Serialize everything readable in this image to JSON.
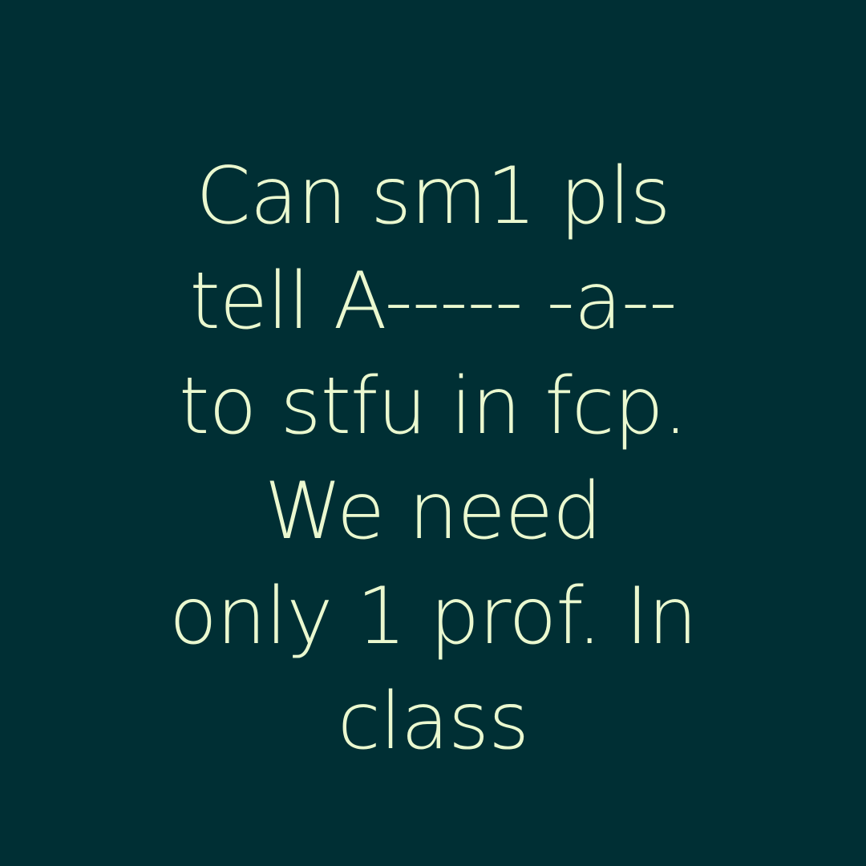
{
  "post": {
    "lines": [
      "Can sm1 pls",
      "tell A----- -a--",
      "to stfu in fcp.",
      "We need",
      "only 1 prof. In",
      "class"
    ]
  },
  "colors": {
    "background": "#002f34",
    "text": "#eaf8cf"
  }
}
